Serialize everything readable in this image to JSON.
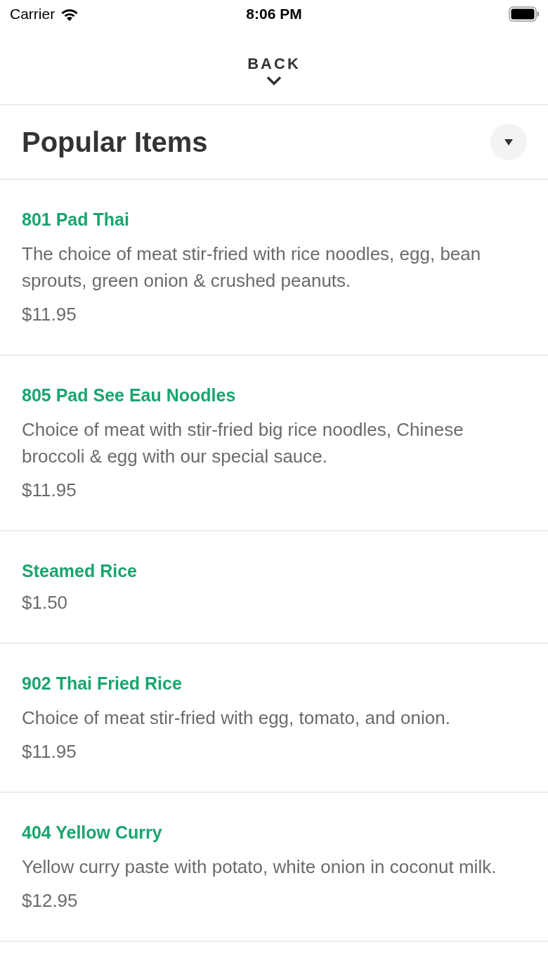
{
  "status_bar": {
    "carrier": "Carrier",
    "time": "8:06 PM"
  },
  "nav": {
    "back_label": "BACK"
  },
  "section": {
    "title": "Popular Items",
    "expanded": true
  },
  "items": [
    {
      "name": "801 Pad Thai",
      "description": "The choice of meat stir-fried with rice noodles, egg, bean sprouts, green onion & crushed peanuts.",
      "price": "$11.95"
    },
    {
      "name": "805 Pad See Eau Noodles",
      "description": "Choice of meat with stir-fried big rice noodles, Chinese broccoli & egg with our special sauce.",
      "price": "$11.95"
    },
    {
      "name": "Steamed Rice",
      "price": "$1.50"
    },
    {
      "name": "902 Thai Fried Rice",
      "description": "Choice of meat stir-fried with egg, tomato, and onion.",
      "price": "$11.95"
    },
    {
      "name": "404 Yellow Curry",
      "description": "Yellow curry paste with potato, white onion in coconut milk.",
      "price": "$12.95"
    }
  ]
}
